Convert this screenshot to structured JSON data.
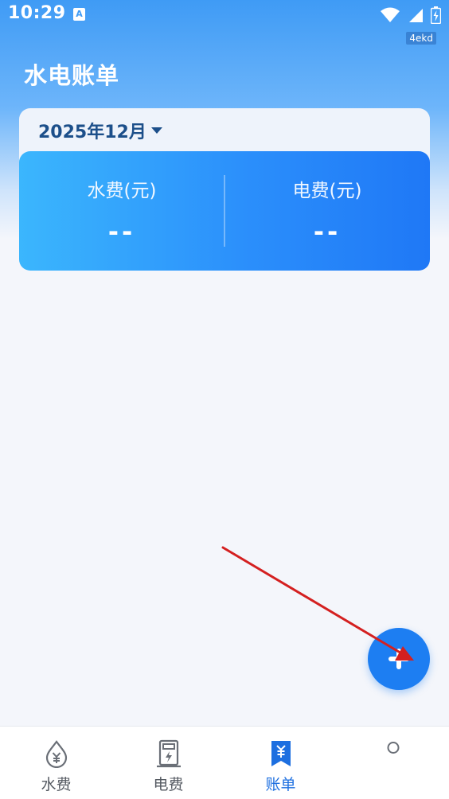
{
  "status_bar": {
    "time": "10:29",
    "notification_glyph": "A",
    "tag": "4ekd",
    "icons": [
      "wifi-icon",
      "cell-signal-icon",
      "battery-icon"
    ]
  },
  "header": {
    "title": "水电账单"
  },
  "summary": {
    "month": "2025年12月",
    "water": {
      "label": "水费(元)",
      "value": "--"
    },
    "electric": {
      "label": "电费(元)",
      "value": "--"
    }
  },
  "fab": {
    "icon": "plus-icon"
  },
  "bottom_nav": {
    "items": [
      {
        "label": "水费",
        "icon": "water-drop-yuan-icon",
        "active": false
      },
      {
        "label": "电费",
        "icon": "electric-meter-icon",
        "active": false
      },
      {
        "label": "账单",
        "icon": "bill-bookmark-icon",
        "active": true
      },
      {
        "label": "",
        "icon": "circle-dot-icon",
        "active": false
      }
    ]
  },
  "colors": {
    "primary": "#1d7ef2",
    "header_gradient_top": "#3f9bf5",
    "panel_gradient_start": "#3bb6fd",
    "panel_gradient_end": "#1f78f6",
    "annotation_arrow": "#d42020",
    "nav_active": "#1d6fe0",
    "background": "#f4f6fb"
  }
}
